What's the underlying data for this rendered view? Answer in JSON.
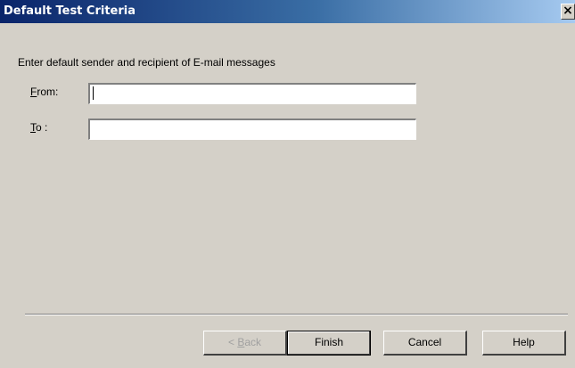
{
  "window": {
    "title": "Default Test Criteria",
    "close_glyph": "×",
    "close_icon": "close-icon"
  },
  "content": {
    "instruction": "Enter default sender and recipient of E-mail messages"
  },
  "fields": {
    "from": {
      "label_accel": "F",
      "label_rest": "rom:",
      "value": ""
    },
    "to": {
      "label_accel": "T",
      "label_rest": "o :",
      "value": ""
    }
  },
  "buttons": {
    "back": {
      "prefix": "< ",
      "accel": "B",
      "rest": "ack",
      "enabled": false
    },
    "finish": {
      "label": "Finish"
    },
    "cancel": {
      "label": "Cancel"
    },
    "help": {
      "label": "Help"
    }
  },
  "colors": {
    "title_gradient_start": "#0a246a",
    "title_gradient_end": "#a6caf0",
    "dialog_face": "#d4d0c8"
  }
}
